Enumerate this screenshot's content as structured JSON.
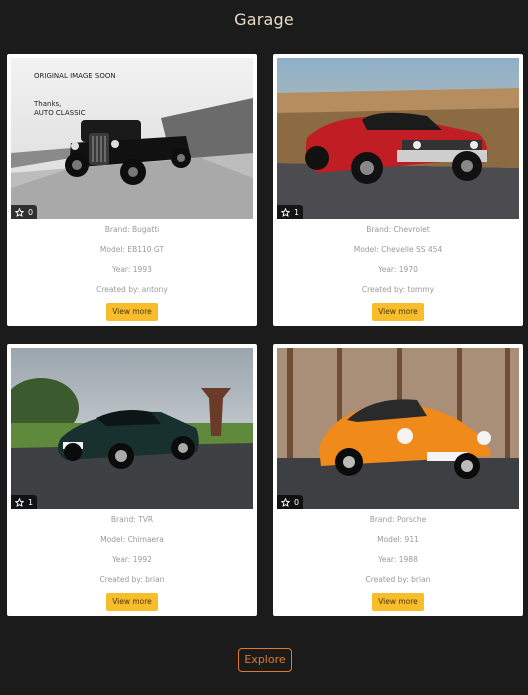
{
  "header": {
    "title": "Garage"
  },
  "cars": [
    {
      "image_note": "ORIGINAL IMAGE SOON",
      "image_note2": "Thanks,",
      "image_note3": "AUTO CLASSIC",
      "favorites": "0",
      "brand": "Brand: Bugatti",
      "model": "Model: EB110 GT",
      "year": "Year: 1993",
      "created_by": "Created by: antony",
      "button": "View more"
    },
    {
      "favorites": "1",
      "brand": "Brand: Chevrolet",
      "model": "Model: Chevelle SS 454",
      "year": "Year: 1970",
      "created_by": "Created by: tommy",
      "button": "View more"
    },
    {
      "favorites": "1",
      "brand": "Brand: TVR",
      "model": "Model: Chimaera",
      "year": "Year: 1992",
      "created_by": "Created by: brian",
      "button": "View more"
    },
    {
      "favorites": "0",
      "brand": "Brand: Porsche",
      "model": "Model: 911",
      "year": "Year: 1988",
      "created_by": "Created by: brian",
      "button": "View more"
    }
  ],
  "footer": {
    "explore_label": "Explore"
  },
  "colors": {
    "background": "#1b1b1b",
    "accent": "#f7bd2a",
    "explore": "#e07a2a"
  }
}
